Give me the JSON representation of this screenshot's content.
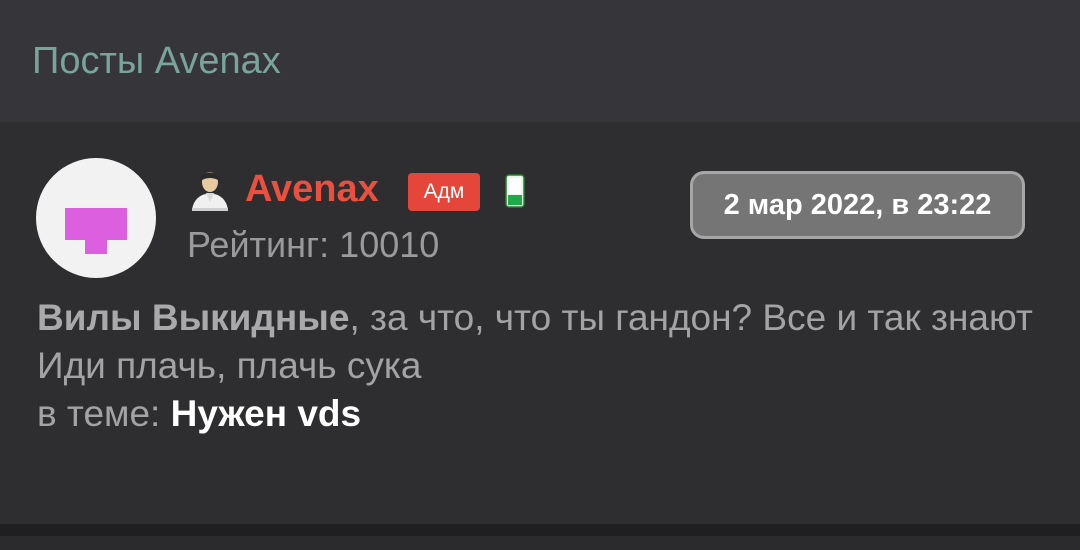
{
  "header": {
    "title": "Посты Avenax"
  },
  "post": {
    "author": {
      "name": "Avenax",
      "badge": "Адм",
      "rating": "Рейтинг: 10010",
      "user_icon": "user-icon",
      "online_icon": "online-status-icon",
      "name_color": "#e9503f"
    },
    "date": "2 мар 2022, в 23:22",
    "body": {
      "mention": "Вилы Выкидные",
      "line1_rest": ", за что, что ты гандон? Все и так знают",
      "line2": "Иди плачь, плачь сука",
      "topic_prefix": "в теме:",
      "topic": "Нужен vds"
    }
  },
  "colors": {
    "header_bg": "#36363a",
    "post_bg": "#2e2e31",
    "title_color": "#7aa39c",
    "badge_bg": "#e4473a",
    "avatar_mark": "#dc5fe0"
  }
}
